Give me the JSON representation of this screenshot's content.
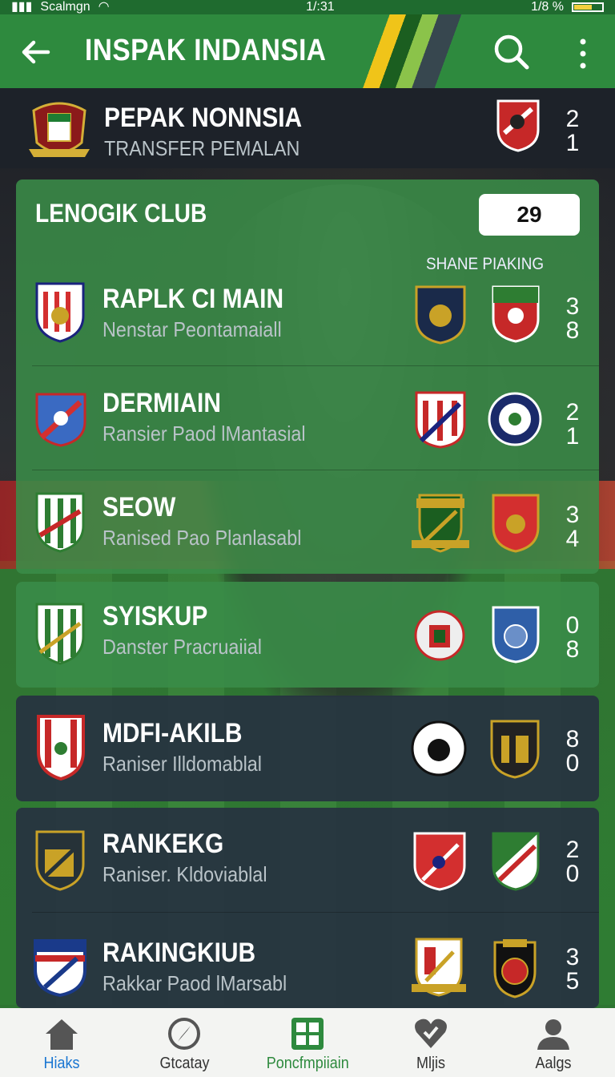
{
  "status_bar": {
    "carrier": "Scalmgn",
    "time": "1/:31",
    "battery_text": "1/8 %"
  },
  "app_bar": {
    "title": "INSPAK INDANSIA"
  },
  "top_row": {
    "title": "PEPAK NONNSIA",
    "subtitle": "TRANSFER PEMALAN",
    "score_top": "2",
    "score_bottom": "1"
  },
  "panel": {
    "title": "LENOGIK CLUB",
    "badge": "29",
    "column_label": "SHANE PIAKING"
  },
  "rows": [
    {
      "title": "RAPLK CI MAIN",
      "subtitle": "Nenstar Peontamaiall",
      "score_top": "3",
      "score_bottom": "8"
    },
    {
      "title": "DERMIAIN",
      "subtitle": "Ransier Paod lMantasial",
      "score_top": "2",
      "score_bottom": "1"
    },
    {
      "title": "SEOW",
      "subtitle": "Ranised Pao Planlasabl",
      "score_top": "3",
      "score_bottom": "4"
    },
    {
      "title": "SYISKUP",
      "subtitle": "Danster Pracruaiial",
      "score_top": "0",
      "score_bottom": "8"
    },
    {
      "title": "MDFI-AKILB",
      "subtitle": "Raniser Illdomablal",
      "score_top": "8",
      "score_bottom": "0"
    },
    {
      "title": "RANKEKG",
      "subtitle": "Raniser. Kldoviablal",
      "score_top": "2",
      "score_bottom": "0"
    },
    {
      "title": "RAKINGKIUB",
      "subtitle": "Rakkar Paod lMarsabl",
      "score_top": "3",
      "score_bottom": "5"
    }
  ],
  "nav": [
    {
      "label": "Hiaks",
      "icon": "home-icon"
    },
    {
      "label": "Gtcatay",
      "icon": "compass-icon"
    },
    {
      "label": "Poncfmpiiain",
      "icon": "grid-icon"
    },
    {
      "label": "Mljis",
      "icon": "heart-icon"
    },
    {
      "label": "Aalgs",
      "icon": "user-icon"
    }
  ],
  "colors": {
    "primary": "#2e8a3e",
    "panel": "#3a8c48",
    "dark_card": "#273440",
    "accent_blue": "#1976d2"
  }
}
